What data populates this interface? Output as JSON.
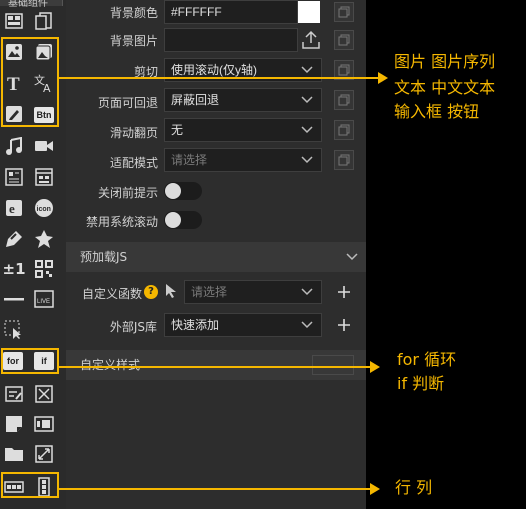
{
  "toolbar": {
    "top_label": "基础组件",
    "for_label": "for",
    "if_label": "if",
    "btn_label": "Btn",
    "icon_label": "icon",
    "counter_label": "±1",
    "live_label": "LIVE"
  },
  "props": {
    "bg_color_label": "背景颜色",
    "bg_color_value": "#FFFFFF",
    "bg_image_label": "背景图片",
    "clip_label": "剪切",
    "clip_value": "使用滚动(仅y轴)",
    "back_label": "页面可回退",
    "back_value": "屏蔽回退",
    "swipe_label": "滑动翻页",
    "swipe_value": "无",
    "fit_label": "适配模式",
    "fit_placeholder": "请选择",
    "close_prompt_label": "关闭前提示",
    "disable_scroll_label": "禁用系统滚动"
  },
  "preload": {
    "title": "预加载JS",
    "custom_fn_label": "自定义函数",
    "custom_fn_placeholder": "请选择",
    "ext_lib_label": "外部JS库",
    "ext_lib_value": "快速添加"
  },
  "custom_style": {
    "title": "自定义样式"
  },
  "annotations": {
    "group1_line1": "图片 图片序列",
    "group1_line2": "文本 中文文本",
    "group1_line3": "输入框 按钮",
    "group2_line1": "for 循环",
    "group2_line2": "if 判断",
    "group3": "行 列"
  },
  "colors": {
    "accent": "#f5b700",
    "panel_bg": "#2d2d2d",
    "toolbar_bg": "#2b2b2b"
  }
}
